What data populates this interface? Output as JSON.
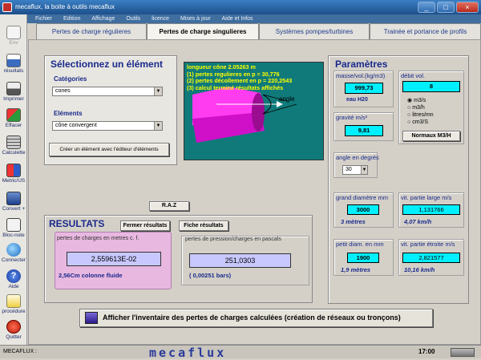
{
  "window": {
    "title": "mecaflux, la boite à outils mecaflux",
    "min": "_",
    "max": "□",
    "close": "×"
  },
  "menu": [
    "Fichier",
    "Edition",
    "Affichage",
    "Outils",
    "licence",
    "Mises à jour",
    "Aide et Infos"
  ],
  "toolbar": [
    {
      "label": "Env",
      "icon": "document-icon"
    },
    {
      "label": "résultats",
      "icon": "results-icon"
    },
    {
      "label": "Imprimer",
      "icon": "printer-icon"
    },
    {
      "label": "Effacer",
      "icon": "erase-icon"
    },
    {
      "label": "Calculette",
      "icon": "calculator-icon"
    },
    {
      "label": "Metric/US",
      "icon": "metric-us-icon"
    },
    {
      "label": "Convert +",
      "icon": "convert-icon"
    },
    {
      "label": "Bloc-note",
      "icon": "notepad-icon"
    },
    {
      "label": "Connecter",
      "icon": "globe-icon"
    },
    {
      "label": "Aide",
      "icon": "help-icon"
    },
    {
      "label": "procédure",
      "icon": "procedure-icon"
    },
    {
      "label": "Quitter",
      "icon": "power-icon"
    }
  ],
  "tabs": [
    {
      "label": "Pertes de charge régulieres"
    },
    {
      "label": "Pertes de charge singulieres"
    },
    {
      "label": "Systèmes pompes/turbines"
    },
    {
      "label": "Trainée et portance de profils"
    }
  ],
  "select": {
    "title": "Sélectionnez un élément",
    "categories_label": "Catégories",
    "categories_value": "cones",
    "elements_label": "Eléments",
    "elements_value": "cône convergent",
    "create_button": "Créer un élément avec l'éditeur d'éléments"
  },
  "viewer": {
    "line1": "longueur cône 2.05263  m",
    "line2": "(1) pertes regulieres en p = 30,776",
    "line3": "(2) pertes décollement en p = 220,2543",
    "line4": "(3) calcul terminé résultats affichés",
    "angle_label": "angle"
  },
  "raz_button": "R.A.Z",
  "results": {
    "title": "RESULTATS",
    "close_button": "Fermer résultats",
    "sheet_button": "Fiche résultats",
    "left_label": "pertes de charges  en  metres c. f.",
    "left_value": "2,559613E-02",
    "left_sub": "2,56Cm colonne fluide",
    "right_label": "pertes de pression/charges en pascals",
    "right_value": "251,0303",
    "right_sub": "( 0,00251 bars)"
  },
  "params": {
    "title": "Paramètres",
    "masse_label": "masse/vol.(kg/m3)",
    "masse_value": "999,73",
    "masse_fluid": "eau H20",
    "debit_label": "débit vol.",
    "debit_value": "8",
    "units": [
      "m3/s",
      "m3/h",
      "litres/mn",
      "cm3/S"
    ],
    "normaux_button": "Normaux M3/H",
    "gravite_label": "gravité m/s²",
    "gravite_value": "9,81",
    "angle_label": "angle en degrés",
    "angle_value": "30",
    "gd_label": "grand diamètre mm",
    "gd_value": "3000",
    "gd_sub": "3 mètres",
    "vlarge_label": "vit. partie large  m/s",
    "vlarge_value": "1,131766",
    "vlarge_sub": "4,07 km/h",
    "pd_label": "petit diam. en mm",
    "pd_value": "1900",
    "pd_sub": "1,9 mètres",
    "vetroite_label": "vit. partie étroite  m/s",
    "vetroite_value": "2,821577",
    "vetroite_sub": "10,16 km/h"
  },
  "inventory_button": "Afficher l'inventaire des pertes de charges calculées (création de réseaux ou tronçons)",
  "status": {
    "left": "MECAFLUX :",
    "brand": "mecaflux",
    "time": "17:00"
  }
}
